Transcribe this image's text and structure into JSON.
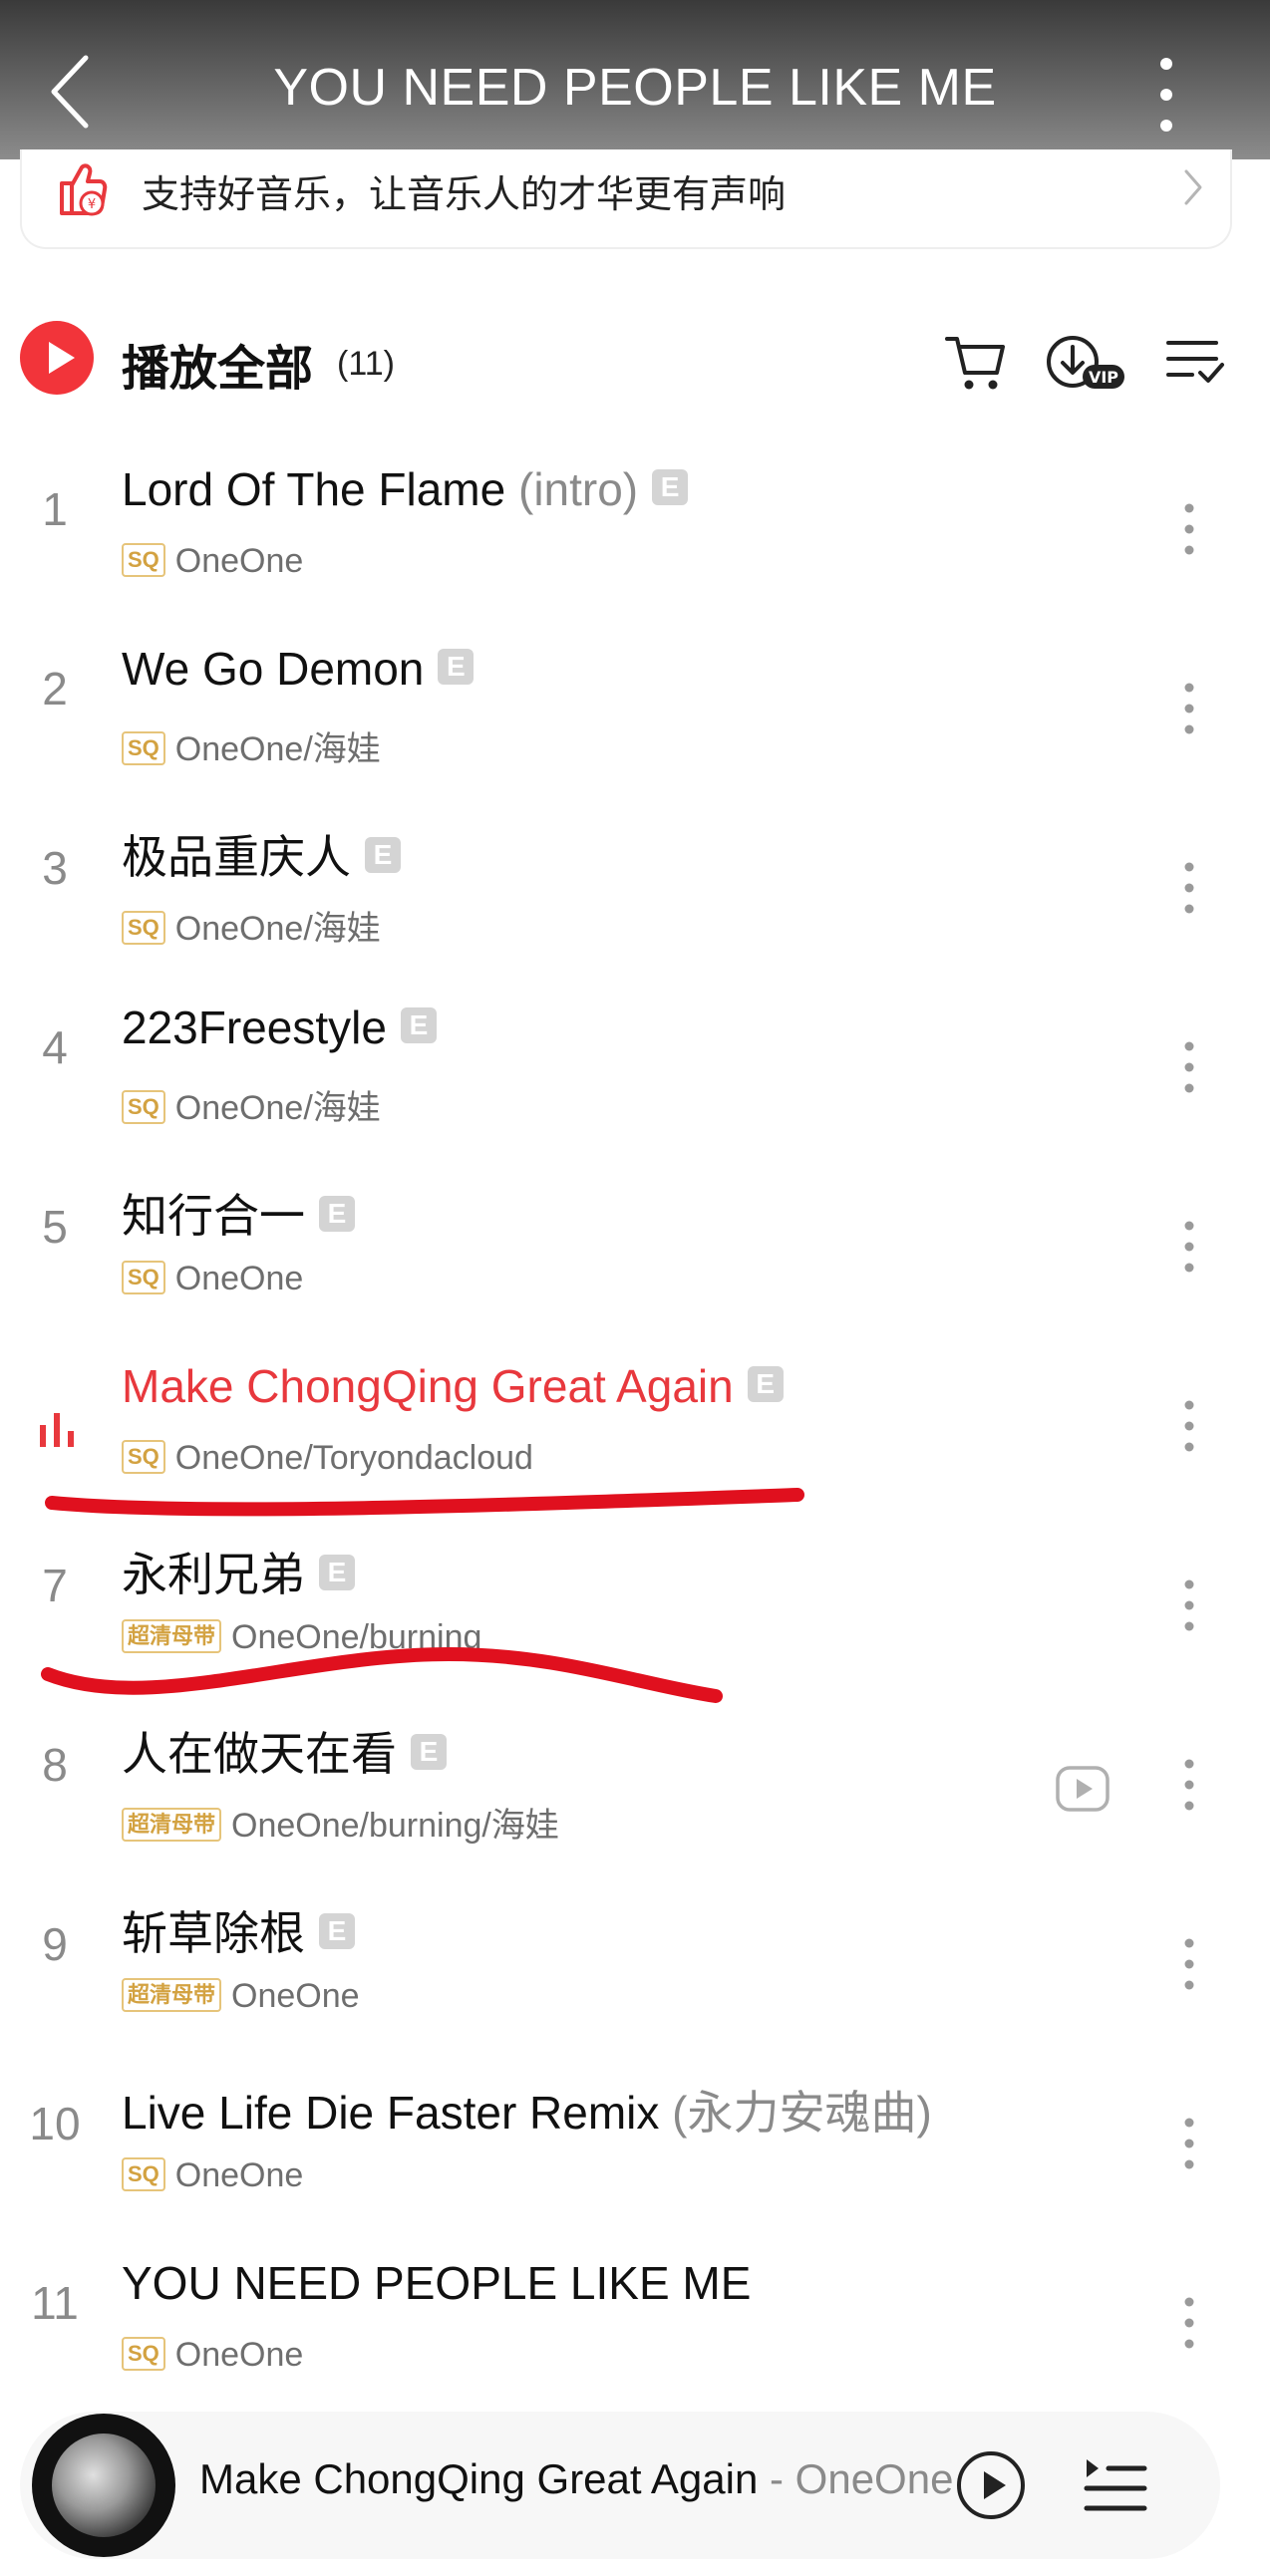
{
  "header": {
    "title": "YOU NEED PEOPLE LIKE ME"
  },
  "banner": {
    "text": "支持好音乐，让音乐人的才华更有声响"
  },
  "playall": {
    "label": "播放全部",
    "count": "(11)"
  },
  "tracks": [
    {
      "num": "1",
      "title": "Lord Of The Flame",
      "suffix": " (intro)",
      "badge": "SQ",
      "artist": "OneOne",
      "explicit": "E"
    },
    {
      "num": "2",
      "title": "We Go Demon",
      "suffix": "",
      "badge": "SQ",
      "artist": "OneOne/海娃",
      "explicit": "E"
    },
    {
      "num": "3",
      "title": "极品重庆人",
      "suffix": "",
      "badge": "SQ",
      "artist": "OneOne/海娃",
      "explicit": "E"
    },
    {
      "num": "4",
      "title": "223Freestyle",
      "suffix": "",
      "badge": "SQ",
      "artist": "OneOne/海娃",
      "explicit": "E"
    },
    {
      "num": "5",
      "title": "知行合一",
      "suffix": "",
      "badge": "SQ",
      "artist": "OneOne",
      "explicit": "E"
    },
    {
      "num": "",
      "title": "Make ChongQing Great Again",
      "suffix": "",
      "badge": "SQ",
      "artist": "OneOne/Toryondacloud",
      "explicit": "E"
    },
    {
      "num": "7",
      "title": "永利兄弟",
      "suffix": "",
      "badge": "超清母带",
      "artist": "OneOne/burning",
      "explicit": "E"
    },
    {
      "num": "8",
      "title": "人在做天在看",
      "suffix": "",
      "badge": "超清母带",
      "artist": "OneOne/burning/海娃",
      "explicit": "E"
    },
    {
      "num": "9",
      "title": "斩草除根",
      "suffix": "",
      "badge": "超清母带",
      "artist": "OneOne",
      "explicit": "E"
    },
    {
      "num": "10",
      "title": "Live Life Die Faster Remix",
      "suffix": " (永力安魂曲)",
      "badge": "SQ",
      "artist": "OneOne",
      "explicit": ""
    },
    {
      "num": "11",
      "title": "YOU NEED PEOPLE LIKE ME",
      "suffix": "",
      "badge": "SQ",
      "artist": "OneOne",
      "explicit": ""
    }
  ],
  "now_playing": {
    "song": "Make ChongQing Great Again",
    "artist": " - OneOne"
  },
  "colors": {
    "accent": "#e8383d",
    "play_button": "#f2343a",
    "annotation": "#e0101e"
  }
}
